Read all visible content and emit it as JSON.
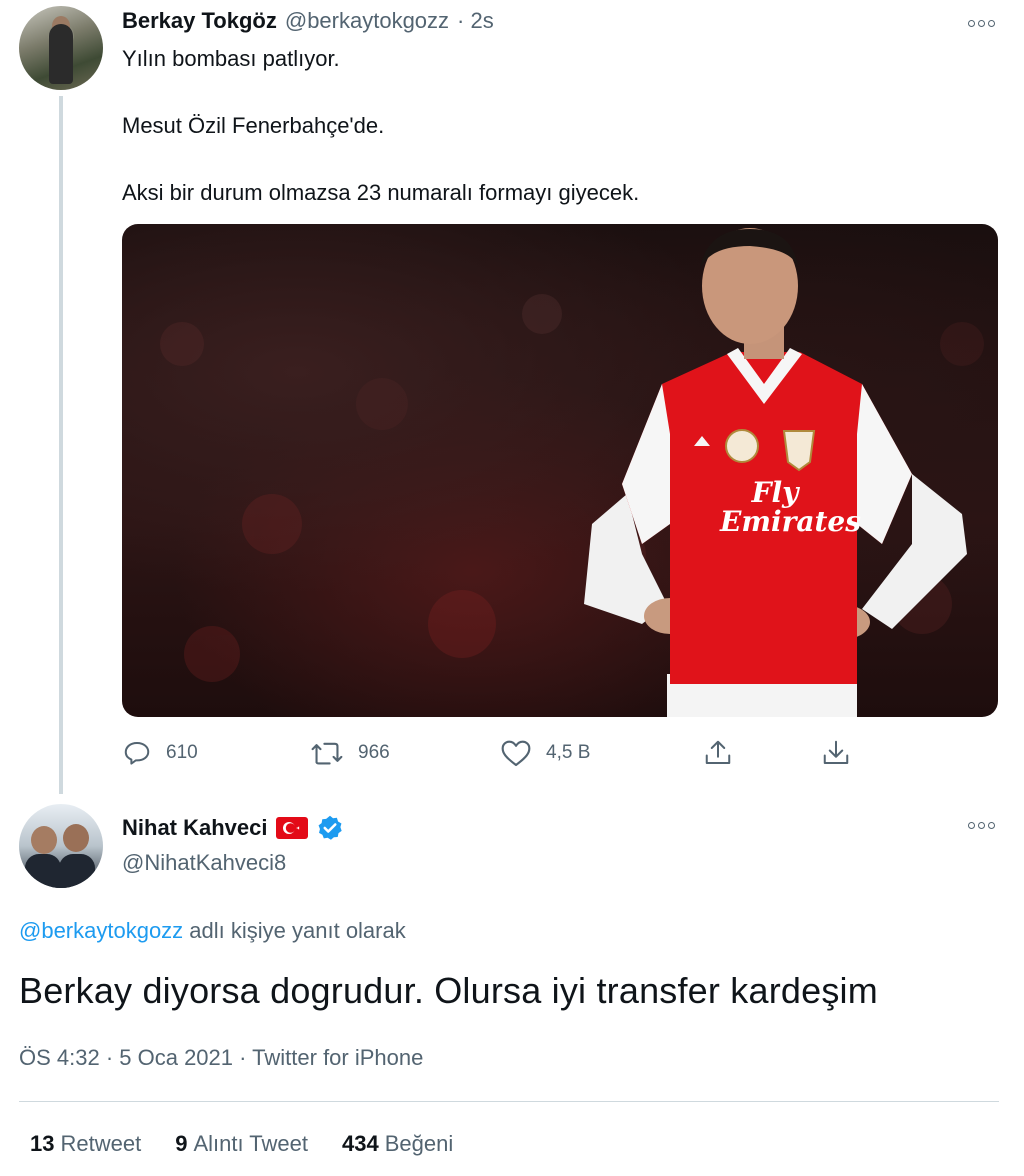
{
  "original_tweet": {
    "author_name": "Berkay Tokgöz",
    "handle": "@berkaytokgozz",
    "time": "· 2s",
    "lines": [
      "Yılın bombası patlıyor.",
      "Mesut Özil Fenerbahçe'de.",
      "Aksi bir durum olmazsa 23 numaralı formayı giyecek."
    ],
    "media": {
      "shirt_sponsor": "Fly Emirates"
    },
    "actions": {
      "reply_count": "610",
      "retweet_count": "966",
      "like_count": "4,5 B"
    }
  },
  "reply_tweet": {
    "author_name": "Nihat Kahveci",
    "handle": "@NihatKahveci8",
    "reply_handle": "@berkaytokgozz",
    "reply_suffix": " adlı kişiye yanıt olarak",
    "text": "Berkay diyorsa dogrudur. Olursa iyi transfer kardeşim",
    "timestamp": "ÖS 4:32 · 5 Oca 2021 · Twitter for iPhone",
    "stats": {
      "retweets_count": "13",
      "retweets_label": "Retweet",
      "quotes_count": "9",
      "quotes_label": "Alıntı Tweet",
      "likes_count": "434",
      "likes_label": "Beğeni"
    }
  },
  "colors": {
    "link": "#1d9bf0",
    "muted": "#536471",
    "verified": "#1d9bf0",
    "flag_red": "#e30a17",
    "arsenal_red": "#db0007"
  },
  "icons": [
    "reply-icon",
    "retweet-icon",
    "like-icon",
    "share-icon",
    "download-icon",
    "more-icon",
    "verified-icon",
    "turkey-flag-icon"
  ]
}
